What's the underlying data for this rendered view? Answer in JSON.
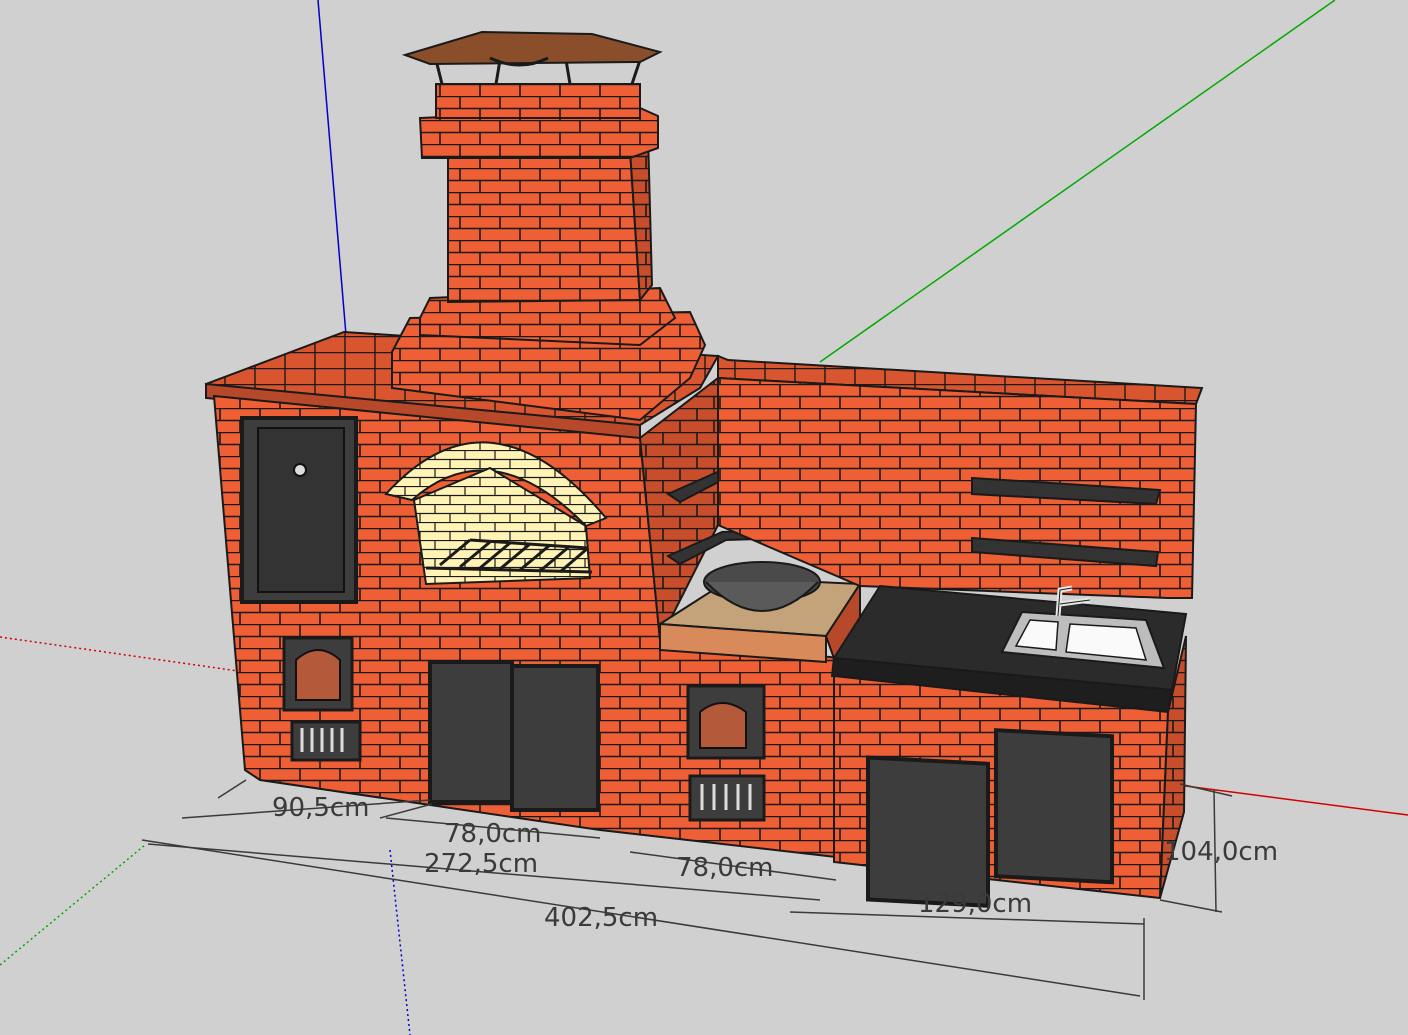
{
  "colors": {
    "background": "#d0d0d0",
    "brick": "#ee5f35",
    "brick_top": "#d9552f",
    "brick_side": "#c84d2a",
    "mortar": "#1a1a1a",
    "firebrick": "#fff3b5",
    "metal": "#3d3d3d",
    "countertop": "#2b2b2b",
    "roof": "#8a4f2a",
    "axis_red": "#d40000",
    "axis_green": "#00aa00",
    "axis_blue": "#0000cc",
    "dimension": "#3a3a3a"
  },
  "objects": {
    "chimney": "chimney-with-cap",
    "oven": "arched-bbq-oven",
    "cooktop": "kazan-wok-stove",
    "sink": "double-sink-with-faucet",
    "countertop": "black-countertop",
    "shelves": "wall-shelves"
  },
  "dimensions": {
    "d1": "90,5cm",
    "d2": "78,0cm",
    "d3": "272,5cm",
    "d4": "78,0cm",
    "d5": "402,5cm",
    "d6": "129,0cm",
    "d7": "104,0cm"
  }
}
